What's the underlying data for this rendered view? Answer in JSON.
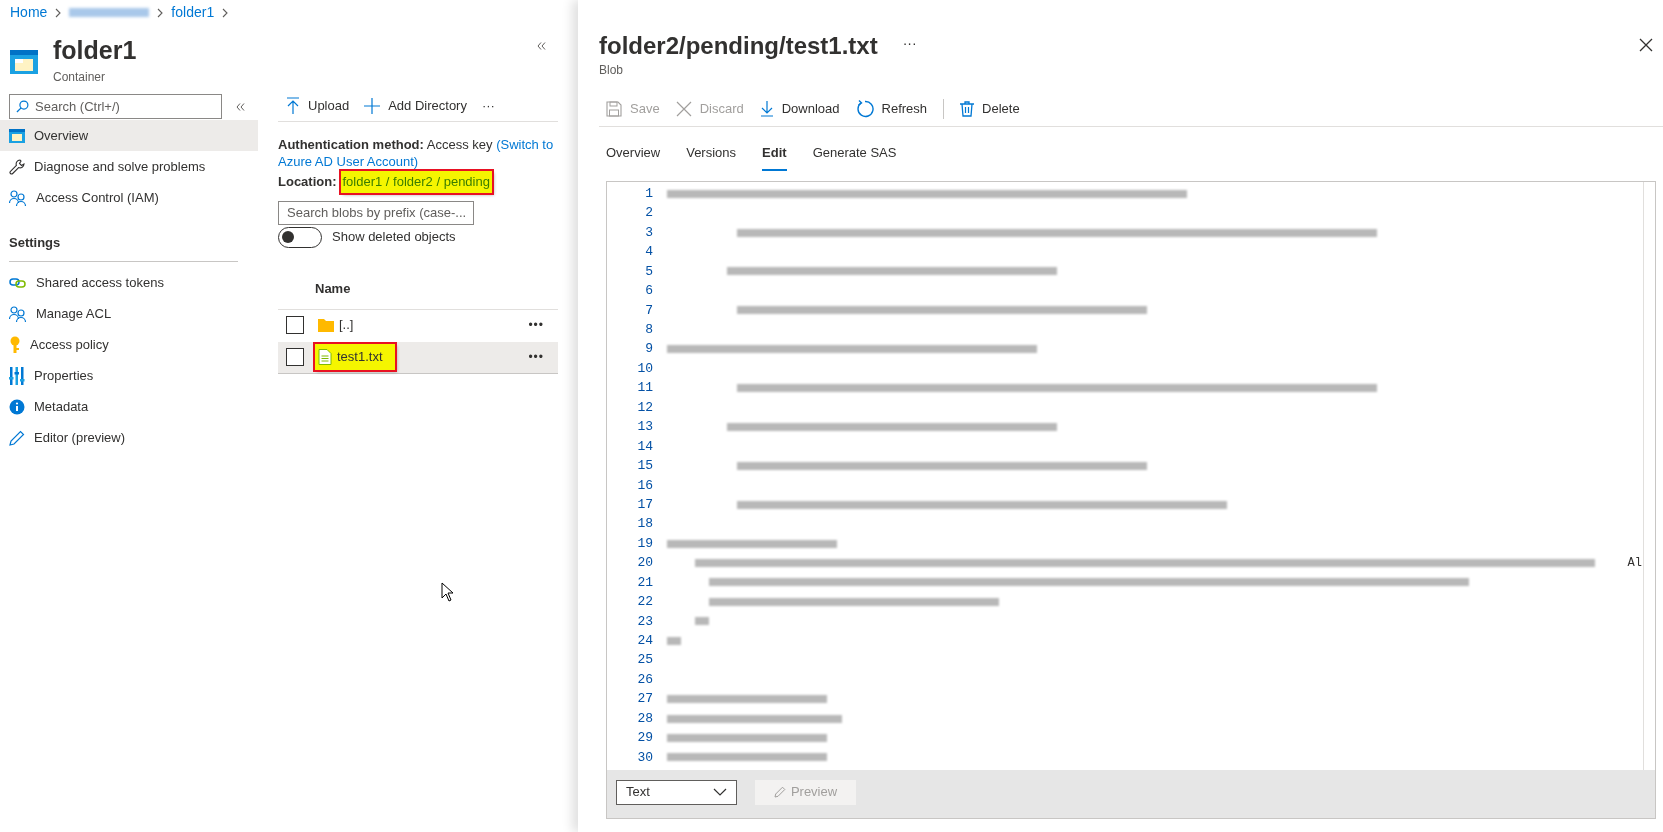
{
  "breadcrumb": [
    {
      "label": "Home",
      "kind": "link"
    },
    {
      "kind": "blurred"
    },
    {
      "label": "folder1",
      "kind": "link"
    }
  ],
  "resource": {
    "title": "folder1",
    "subtitle": "Container"
  },
  "menu_search": {
    "placeholder": "Search (Ctrl+/)"
  },
  "menu": [
    {
      "label": "Overview",
      "kind": "container",
      "selected": true
    },
    {
      "label": "Diagnose and solve problems",
      "kind": "wrench",
      "selected": false
    },
    {
      "label": "Access Control (IAM)",
      "kind": "people",
      "selected": false
    }
  ],
  "settings": {
    "title": "Settings",
    "items": [
      {
        "label": "Shared access tokens",
        "kind": "link",
        "selected": false
      },
      {
        "label": "Manage ACL",
        "kind": "people",
        "selected": false
      },
      {
        "label": "Access policy",
        "kind": "key",
        "selected": false
      },
      {
        "label": "Properties",
        "kind": "bars",
        "selected": false
      },
      {
        "label": "Metadata",
        "kind": "info",
        "selected": false
      },
      {
        "label": "Editor (preview)",
        "kind": "pencil",
        "selected": false
      }
    ]
  },
  "container_toolbar": [
    {
      "label": "Upload",
      "kind": "upload"
    },
    {
      "label": "Add Directory",
      "kind": "plus"
    },
    {
      "label": "···",
      "kind": "more"
    }
  ],
  "auth": {
    "label": "Authentication method:",
    "value": "Access key",
    "link": "(Switch to Azure AD User Account)"
  },
  "location": {
    "label": "Location:",
    "path": "folder1 / folder2 / pending",
    "highlighted": true
  },
  "blob_search": {
    "placeholder": "Search blobs by prefix (case-..."
  },
  "show_deleted": {
    "label": "Show deleted objects",
    "on": false
  },
  "blob_table": {
    "columns": [
      "Name"
    ],
    "rows": [
      {
        "name": "[..]",
        "kind": "folder",
        "checked": false,
        "selected": false,
        "highlighted": false,
        "more": "•••"
      },
      {
        "name": "test1.txt",
        "kind": "file",
        "checked": false,
        "selected": true,
        "highlighted": true,
        "more": "•••"
      }
    ]
  },
  "blob_panel": {
    "title": "folder2/pending/test1.txt",
    "more": "···",
    "subtitle": "Blob",
    "toolbar": [
      {
        "label": "Save",
        "kind": "save",
        "disabled": true
      },
      {
        "label": "Discard",
        "kind": "close",
        "disabled": true
      },
      {
        "label": "Download",
        "kind": "download",
        "disabled": false
      },
      {
        "label": "Refresh",
        "kind": "refresh",
        "disabled": false
      },
      {
        "label": "Delete",
        "kind": "trash",
        "disabled": false
      }
    ],
    "tabs": [
      {
        "label": "Overview",
        "selected": false
      },
      {
        "label": "Versions",
        "selected": false
      },
      {
        "label": "Edit",
        "selected": true
      },
      {
        "label": "Generate SAS",
        "selected": false
      }
    ],
    "editor": {
      "lines": [
        {
          "number": "1"
        },
        {
          "number": "2"
        },
        {
          "number": "3"
        },
        {
          "number": "4"
        },
        {
          "number": "5"
        },
        {
          "number": "6"
        },
        {
          "number": "7"
        },
        {
          "number": "8"
        },
        {
          "number": "9"
        },
        {
          "number": "10"
        },
        {
          "number": "11"
        },
        {
          "number": "12"
        },
        {
          "number": "13"
        },
        {
          "number": "14"
        },
        {
          "number": "15"
        },
        {
          "number": "16"
        },
        {
          "number": "17"
        },
        {
          "number": "18"
        },
        {
          "number": "19"
        },
        {
          "number": "20",
          "tail": "Al"
        },
        {
          "number": "21"
        },
        {
          "number": "22"
        },
        {
          "number": "23"
        },
        {
          "number": "24"
        },
        {
          "number": "25"
        },
        {
          "number": "26"
        },
        {
          "number": "27"
        },
        {
          "number": "28"
        },
        {
          "number": "29"
        },
        {
          "number": "30"
        }
      ]
    },
    "language": {
      "value": "Text"
    },
    "preview": {
      "label": "Preview",
      "disabled": true
    }
  }
}
